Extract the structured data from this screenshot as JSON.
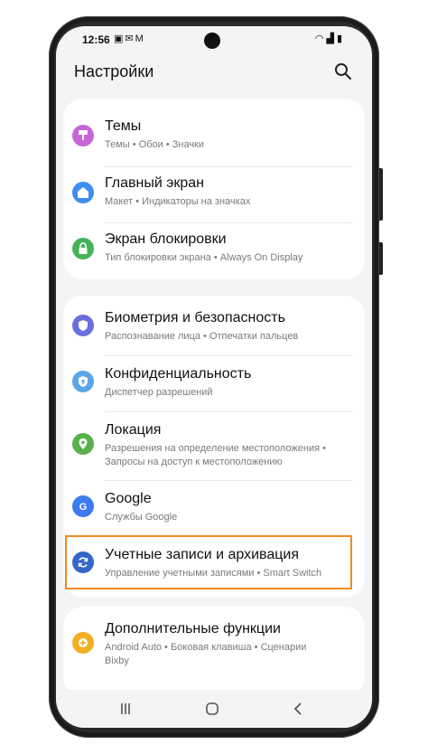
{
  "status_bar": {
    "time": "12:56",
    "notification_icons": [
      "image-icon",
      "mail-icon",
      "gmail-icon"
    ],
    "system_icons": [
      "wifi-icon",
      "signal-icon",
      "battery-icon"
    ]
  },
  "header": {
    "title": "Настройки",
    "search_icon": "search-icon"
  },
  "sections": [
    {
      "items": [
        {
          "id": "themes",
          "title": "Темы",
          "subtitle": "Темы • Обои • Значки",
          "icon": "themes-icon",
          "color": "#c667d8"
        },
        {
          "id": "home",
          "title": "Главный экран",
          "subtitle": "Макет • Индикаторы на значках",
          "icon": "home-icon",
          "color": "#3f8df0"
        },
        {
          "id": "lock",
          "title": "Экран блокировки",
          "subtitle": "Тип блокировки экрана • Always On Display",
          "icon": "lock-icon",
          "color": "#46b35a"
        }
      ]
    },
    {
      "items": [
        {
          "id": "biometrics",
          "title": "Биометрия и безопасность",
          "subtitle": "Распознавание лица • Отпечатки пальцев",
          "icon": "shield-icon",
          "color": "#6a6fde"
        },
        {
          "id": "privacy",
          "title": "Конфиденциальность",
          "subtitle": "Диспетчер разрешений",
          "icon": "privacy-icon",
          "color": "#5aa6e6"
        },
        {
          "id": "location",
          "title": "Локация",
          "subtitle_line1": "Разрешения на определение местоположения •",
          "subtitle_line2": "Запросы на доступ к местоположению",
          "icon": "location-icon",
          "color": "#58b14c"
        },
        {
          "id": "google",
          "title": "Google",
          "subtitle": "Службы Google",
          "icon": "google-icon",
          "color": "#3d7bef"
        },
        {
          "id": "accounts",
          "title": "Учетные записи и архивация",
          "subtitle": "Управление учетными записями • Smart Switch",
          "icon": "sync-icon",
          "color": "#3566c7",
          "highlight_color": "#f08a24"
        }
      ]
    },
    {
      "items": [
        {
          "id": "advanced",
          "title": "Дополнительные функции",
          "subtitle_line1": "Android Auto • Боковая клавиша • Сценарии",
          "subtitle_line2": "Bixby",
          "icon": "gear-plus-icon",
          "color": "#f2b022"
        }
      ]
    }
  ],
  "nav_bar": {
    "recents": "recents-icon",
    "home": "home-button-icon",
    "back": "back-icon"
  }
}
